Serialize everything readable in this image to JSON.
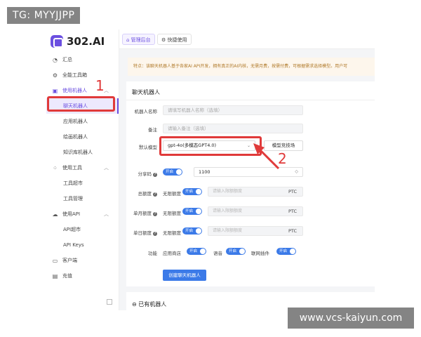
{
  "watermarks": {
    "top_left": "TG: MYYJJPP",
    "bottom_right": "www.vcs-kaiyun.com"
  },
  "app": {
    "logo_text": "302.AI",
    "brand_color": "#6b4fe0",
    "accent_color": "#3b7ae8",
    "annotation_color": "#e03a3a"
  },
  "topbar": {
    "tabs": [
      {
        "label": "管理后台",
        "icon": "home-icon",
        "active": true
      },
      {
        "label": "快捷使用",
        "icon": "gear-icon",
        "active": false
      }
    ]
  },
  "sidebar": {
    "items": [
      {
        "label": "汇总",
        "icon": "summary-icon"
      },
      {
        "label": "全能工具箱",
        "icon": "toolbox-icon"
      },
      {
        "label": "使用机器人",
        "icon": "robot-icon",
        "expanded": true
      },
      {
        "label": "聊天机器人",
        "sub": true,
        "active": true
      },
      {
        "label": "应用机器人",
        "sub": true
      },
      {
        "label": "绘画机器人",
        "sub": true
      },
      {
        "label": "知识库机器人",
        "sub": true
      },
      {
        "label": "使用工具",
        "icon": "tools-icon",
        "expanded": true
      },
      {
        "label": "工具超市",
        "sub": true
      },
      {
        "label": "工具管理",
        "sub": true
      },
      {
        "label": "使用API",
        "icon": "cloud-icon",
        "expanded": true
      },
      {
        "label": "API超市",
        "sub": true
      },
      {
        "label": "API Keys",
        "sub": true
      },
      {
        "label": "客户端",
        "icon": "monitor-icon"
      },
      {
        "label": "充值",
        "icon": "wallet-icon"
      }
    ]
  },
  "notice": {
    "text": "特点：该聊天机器人基于各家AI API开发，拥有真正的AI内核，无需月费，按需付费，可根据需求选择模型。用户可"
  },
  "form": {
    "title": "聊天机器人",
    "name": {
      "label": "机器人名称",
      "placeholder": "请填写机器人名称（选填）"
    },
    "remark": {
      "label": "备注",
      "placeholder": "请输入备注（选填）"
    },
    "model": {
      "label": "默认模型",
      "value": "gpt-4o(多模态GPT4.0)",
      "tips_button": "模型竞技场"
    },
    "share_code": {
      "label": "分享码",
      "toggle": "开启",
      "value": "1100"
    },
    "total_quota": {
      "label": "总额度",
      "unlimited": "无限额度",
      "toggle": "开启",
      "placeholder": "请输入限额额度",
      "unit": "PTC"
    },
    "monthly_quota": {
      "label": "单月额度",
      "unlimited": "无限额度",
      "toggle": "开启",
      "placeholder": "请输入限额额度",
      "unit": "PTC"
    },
    "daily_quota": {
      "label": "单日额度",
      "unlimited": "无限额度",
      "toggle": "开启",
      "placeholder": "请输入限额额度",
      "unit": "PTC"
    },
    "features": {
      "label": "功能",
      "items": [
        {
          "label": "应用商店",
          "toggle": "开启"
        },
        {
          "label": "语音",
          "toggle": "开启"
        },
        {
          "label": "联网插件",
          "toggle": "开启"
        }
      ]
    },
    "create_button": "创建聊天机器人"
  },
  "existing": {
    "title": "已有机器人"
  },
  "annotations": {
    "one": "1",
    "two": "2"
  }
}
